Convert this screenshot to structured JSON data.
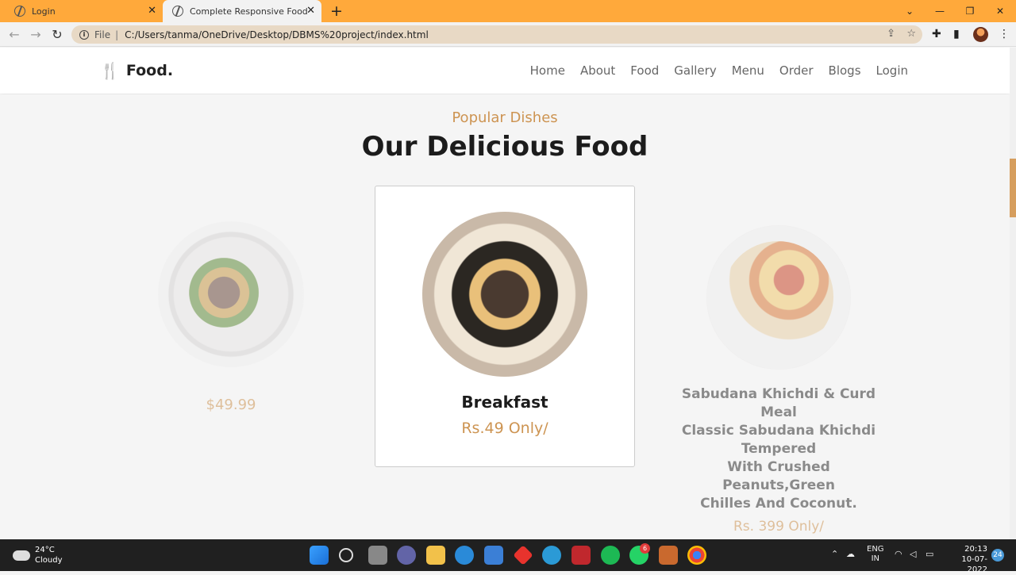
{
  "browser": {
    "tabs": [
      {
        "label": "Login"
      },
      {
        "label": "Complete Responsive Food / Res"
      }
    ],
    "new_tab_glyph": "+",
    "url_scheme_label": "File",
    "url": "C:/Users/tanma/OneDrive/Desktop/DBMS%20project/index.html"
  },
  "site": {
    "logo_text": "Food.",
    "nav": [
      "Home",
      "About",
      "Food",
      "Gallery",
      "Menu",
      "Order",
      "Blogs",
      "Login"
    ]
  },
  "section": {
    "subtitle": "Popular Dishes",
    "title": "Our Delicious Food"
  },
  "cards": [
    {
      "name": "",
      "price": "$49.99"
    },
    {
      "name": "Breakfast",
      "price": "Rs.49 Only/"
    },
    {
      "name_lines": [
        "Sabudana Khichdi & Curd Meal",
        "Classic Sabudana Khichdi Tempered",
        "With Crushed Peanuts,Green",
        "Chilles And Coconut."
      ],
      "price": "Rs. 399 Only/"
    }
  ],
  "taskbar": {
    "temperature": "24°C",
    "weather": "Cloudy",
    "language": "ENG",
    "region": "IN",
    "time": "20:13",
    "date": "10-07-2022",
    "notification_count": "24",
    "whatsapp_badge": "6"
  },
  "colors": {
    "tabbar": "#ffa93b",
    "accent": "#cd9452",
    "scroll_thumb": "#d69e5e"
  }
}
